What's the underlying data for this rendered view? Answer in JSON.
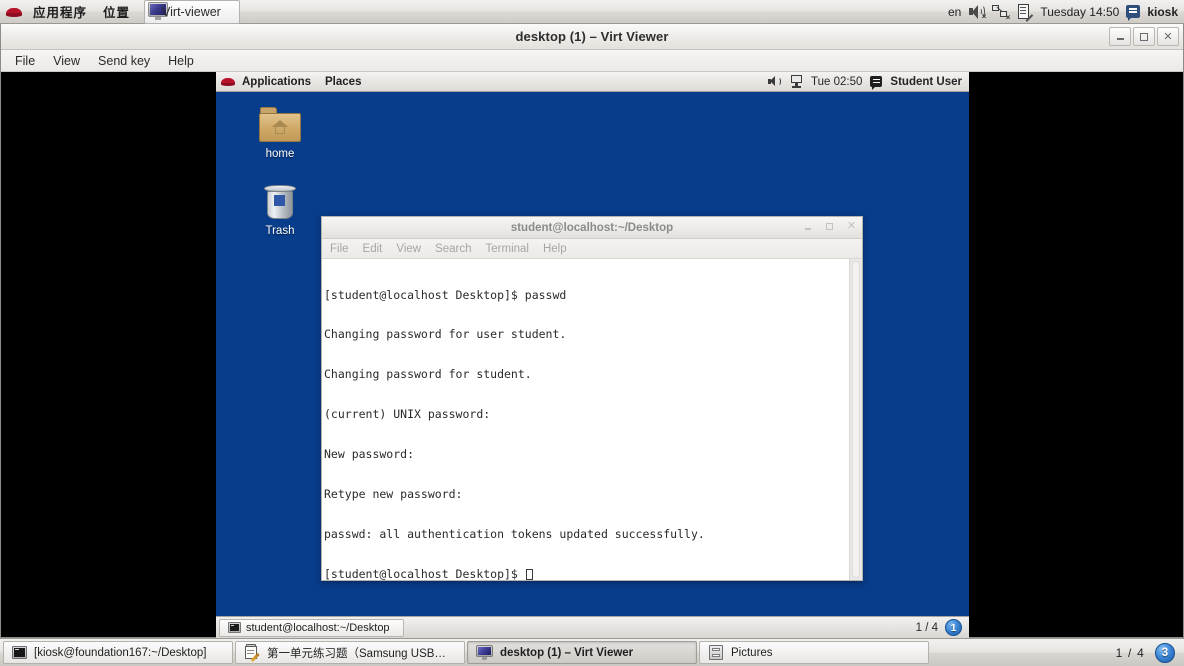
{
  "host_panel": {
    "menus": [
      {
        "label": "应用程序",
        "name": "applications"
      },
      {
        "label": "位置",
        "name": "places"
      }
    ],
    "window_thumb_label": "Virt-viewer",
    "tray": {
      "keyboard_layout": "en",
      "clock": "Tuesday 14:50",
      "user": "kiosk"
    }
  },
  "vv_window": {
    "title": "desktop (1) – Virt Viewer",
    "menus": [
      "File",
      "View",
      "Send key",
      "Help"
    ],
    "window_buttons": {
      "minimize": "–",
      "restore": "❐",
      "close": "✕"
    }
  },
  "guest": {
    "panel": {
      "menus": [
        "Applications",
        "Places"
      ],
      "clock": "Tue 02:50",
      "user": "Student User"
    },
    "desktop_icons": [
      {
        "label": "home",
        "icon": "home-folder-icon"
      },
      {
        "label": "Trash",
        "icon": "trash-icon"
      }
    ],
    "terminal": {
      "title": "student@localhost:~/Desktop",
      "menus": [
        "File",
        "Edit",
        "View",
        "Search",
        "Terminal",
        "Help"
      ],
      "lines": [
        "[student@localhost Desktop]$ passwd",
        "Changing password for user student.",
        "Changing password for student.",
        "(current) UNIX password:",
        "New password:",
        "Retype new password:",
        "passwd: all authentication tokens updated successfully.",
        "[student@localhost Desktop]$ "
      ]
    },
    "bottom_panel": {
      "task_label": "student@localhost:~/Desktop",
      "workspace_text": "1 / 4",
      "workspace_current": "1"
    }
  },
  "host_taskbar": {
    "tasks": [
      {
        "label": "[kiosk@foundation167:~/Desktop]",
        "icon": "terminal-icon",
        "active": false
      },
      {
        "label": "第一单元练习题（Samsung USB…",
        "icon": "document-edit-icon",
        "active": false
      },
      {
        "label": "desktop (1) – Virt Viewer",
        "icon": "virt-viewer-icon",
        "active": true
      },
      {
        "label": "Pictures",
        "icon": "file-manager-icon",
        "active": false
      }
    ],
    "workspace_text": "1 / 4",
    "workspace_current": "3"
  },
  "colors": {
    "desktop_blue": "#083d8c",
    "panel_gray": "#e6e4e1",
    "accent_blue": "#3b85d6",
    "redhat_red": "#b8112a"
  }
}
